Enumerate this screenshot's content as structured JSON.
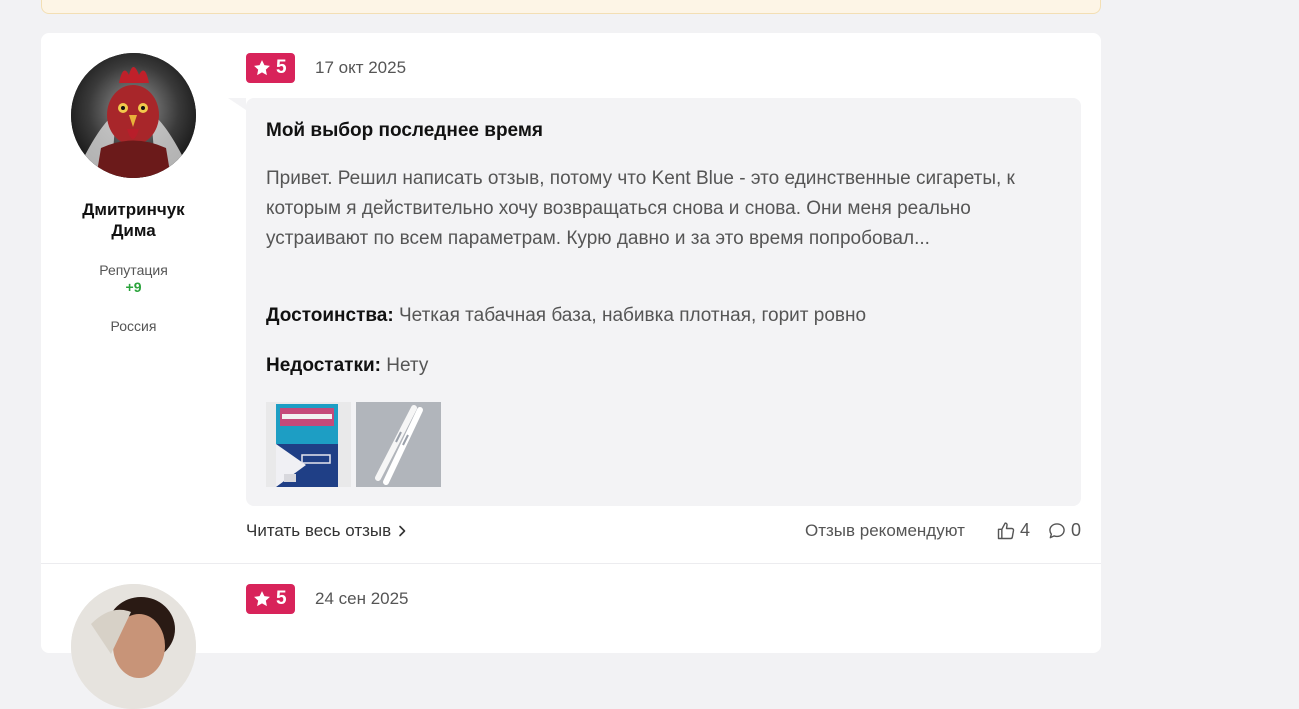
{
  "review": {
    "author": "Дмитринчук Дима",
    "reputation_label": "Репутация",
    "reputation_value": "+9",
    "country": "Россия",
    "rating": "5",
    "date": "17 окт 2025",
    "title": "Мой выбор последнее время",
    "text": "Привет. Решил написать отзыв, потому что Kent Blue - это единственные сигареты, к которым я действительно хочу возвращаться снова и снова. Они меня реально устраивают по всем параметрам. Курю давно и за это время попробовал...",
    "pros_label": "Достоинства:",
    "pros_text": "Четкая табачная база, набивка плотная, горит ровно",
    "cons_label": "Недостатки:",
    "cons_text": "Нету",
    "read_more": "Читать весь отзыв",
    "recommend_label": "Отзыв рекомендуют",
    "likes": "4",
    "comments": "0",
    "thumbnails": [
      {
        "icon": "cigarette-pack-photo"
      },
      {
        "icon": "cigarette-sticks-photo"
      }
    ]
  },
  "review2": {
    "rating": "5",
    "date": "24 сен 2025"
  },
  "colors": {
    "accent": "#d8235a",
    "reputation": "#2aa33b",
    "bubble": "#f3f3f5"
  }
}
